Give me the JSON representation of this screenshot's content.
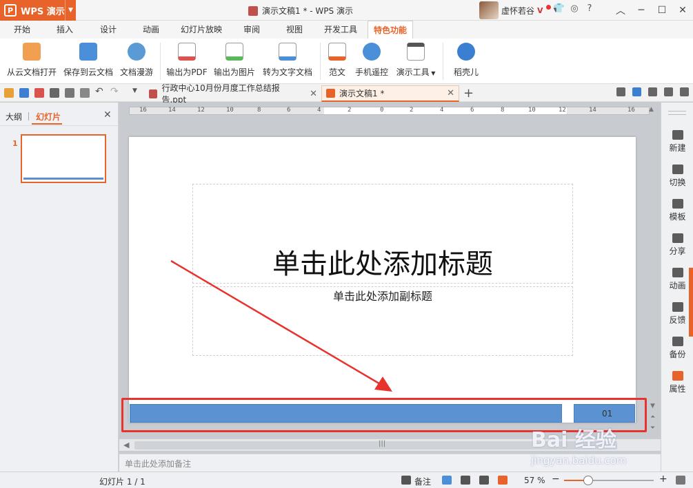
{
  "app": {
    "name": "WPS 演示",
    "logo_letter": "P"
  },
  "window": {
    "title": "演示文稿1 * - WPS 演示"
  },
  "user": {
    "name": "虚怀若谷"
  },
  "menu": [
    "开始",
    "插入",
    "设计",
    "动画",
    "幻灯片放映",
    "审阅",
    "视图",
    "开发工具",
    "特色功能"
  ],
  "menu_active_index": 8,
  "ribbon": {
    "buttons": [
      "从云文档打开",
      "保存到云文档",
      "文档漫游",
      "输出为PDF",
      "输出为图片",
      "转为文字文档",
      "范文",
      "手机遥控",
      "演示工具",
      "稻壳儿"
    ]
  },
  "doc_tabs": [
    {
      "label": "行政中心10月份月度工作总结报告.ppt",
      "active": false
    },
    {
      "label": "演示文稿1 *",
      "active": true
    }
  ],
  "left_panel": {
    "tab_outline": "大纲",
    "tab_slides": "幻灯片",
    "slide_number": "1"
  },
  "ruler_labels": [
    "16",
    "14",
    "12",
    "10",
    "8",
    "6",
    "4",
    "2",
    "0",
    "2",
    "4",
    "6",
    "8",
    "10",
    "12",
    "14",
    "16"
  ],
  "slide": {
    "title_placeholder": "单击此处添加标题",
    "subtitle_placeholder": "单击此处添加副标题",
    "footer_number": "01"
  },
  "notes_placeholder": "单击此处添加备注",
  "right_sidebar": [
    "新建",
    "切换",
    "模板",
    "分享",
    "动画",
    "反馈",
    "备份",
    "属性"
  ],
  "status": {
    "slide_counter": "幻灯片 1 / 1",
    "notes_label": "备注",
    "zoom": "57 %",
    "zoom_fraction": 0.27
  },
  "watermark": {
    "main": "Bai 经验",
    "url": "jingyan.baidu.com"
  },
  "colors": {
    "accent": "#e8632a",
    "footer_blue": "#5b92d2",
    "annotation_red": "#e8322c"
  }
}
